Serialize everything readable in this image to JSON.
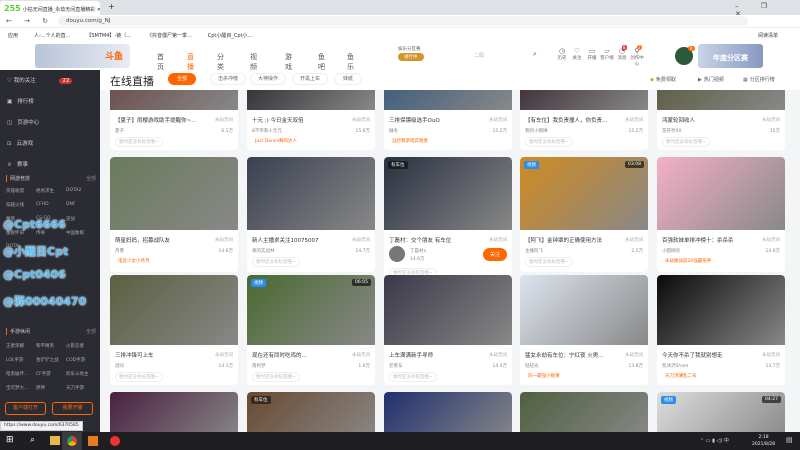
{
  "browser": {
    "tab_title": "小枯无间直播_永劫无间直播精彩",
    "tab_logo": "255",
    "url": "douyu.com/g_NJ",
    "bookmarks": [
      "应用",
      "人-...个人的直...",
      "【SMTM4】-链（...",
      "《抖音僵尸第一季...",
      "Cpt小醒目_Cpt小..."
    ],
    "reading_list": "阅读清单"
  },
  "site": {
    "logo": "斗鱼",
    "nav": [
      "首页",
      "直播",
      "分类",
      "视频",
      "游戏",
      "鱼吧",
      "鱼乐盛典"
    ],
    "promo": "娱乐分区赛",
    "promo_badge": "进行中",
    "search_placeholder": "二阳",
    "tools": [
      "历史",
      "关注",
      "开播",
      "客户端",
      "消息",
      "创作中心"
    ],
    "badges": {
      "client": "8",
      "msg": "3",
      "avatar": "6"
    },
    "banner": "年度分区赛"
  },
  "sidebar": {
    "follow": "我的关注",
    "follow_count": "22",
    "items": [
      "排行榜",
      "页游中心",
      "云游戏",
      "赛事"
    ],
    "pc": {
      "title": "网游竞技",
      "all": "全部",
      "games": [
        "英雄联盟",
        "绝地求生",
        "DOTA2",
        "穿越火线",
        "CFHD",
        "DNF",
        "魔兽",
        "CS:GO",
        "逆战",
        "魔兽怀旧",
        "传奇",
        "中国象棋",
        "DOTA"
      ]
    },
    "mobile": {
      "title": "手游休闲",
      "all": "全部",
      "games": [
        "王者荣耀",
        "和平精英",
        "火影忍者",
        "LOL手游",
        "金铲铲之战",
        "COD手游",
        "暗黑破坏...",
        "CF手游",
        "欢乐斗地主",
        "宝可梦大...",
        "原神",
        "天刀手游"
      ]
    },
    "open_client": "客户端打开",
    "start_stream": "我要开播",
    "watermarks": [
      "@Cpt6666",
      "@小醒目Cpt",
      "@Cpt0406",
      "@驿00040470"
    ]
  },
  "main": {
    "title": "在线直播",
    "filters": [
      "全部",
      "击杀冲榜",
      "大神操作",
      "开黑上车",
      "妹纸"
    ],
    "actions": [
      "免费领取",
      "热门视频",
      "分区排行榜"
    ],
    "cards": [
      {
        "title": "【夏子】雨樱游戏助手提醒你~...",
        "game": "永劫无间",
        "anchor": "夏子",
        "views": "6.1万",
        "tag": "暂时还没有标签哦~",
        "tag_type": "grey",
        "color": "#6a4a4a"
      },
      {
        "title": "十元 :) 今日金天双倍",
        "game": "永劫无间",
        "anchor": "8不带刺十元元",
        "views": "15.6万",
        "tag": "Just Dance舞的达人",
        "tag_type": "orange",
        "color": "#2a2a30"
      },
      {
        "title": "三排保镖级选手OuO",
        "game": "永劫无间",
        "anchor": "珊冬",
        "views": "15.2万",
        "tag": "远控教游戏奔跑者",
        "tag_type": "orange",
        "color": "#3a5a7a"
      },
      {
        "title": "【有车位】我负责撞人，你负责...",
        "game": "永劫无间",
        "anchor": "我的小钢琳",
        "views": "15.2万",
        "tag": "暂时还没有标签哦~",
        "tag_type": "grey",
        "color": "#3a2a34"
      },
      {
        "title": "鸿蒙轮回收人",
        "game": "永劫无间",
        "anchor": "花开乔XX",
        "views": "15万",
        "tag": "暂时还没有标签哦~",
        "tag_type": "grey",
        "color": "#5a5a40"
      },
      {
        "title": "萌星妈妈，招募战队友",
        "game": "永劫无间",
        "anchor": "月熹",
        "views": "14.6万",
        "tag": "电竞少女小月月",
        "tag_type": "orange",
        "color": "#6a7a5a"
      },
      {
        "title": "新人主播求关注10075007",
        "game": "永劫无间",
        "anchor": "真的实战林",
        "views": "14.7万",
        "tag": "暂时还没有标签哦~",
        "tag_type": "grey",
        "color": "#3a4050"
      },
      {
        "title": "丁磊村：交个朋友 有车位",
        "game": "永劫无间",
        "anchor": "丁磊村x",
        "views": "14.6万",
        "tag": "暂时还没有标签哦~",
        "tag_type": "grey",
        "color": "#2a3040",
        "follow": "关注",
        "badge": "有车位"
      },
      {
        "title": "【阿飞】金钟罩的正确使用方法",
        "game": "永劫无间",
        "anchor": "主播阿飞",
        "views": "2.5万",
        "tag": "暂时还没有标签哦~",
        "tag_type": "grey",
        "color": "#d08a20",
        "badge": "视频",
        "duration": "03:08"
      },
      {
        "title": "百强软妹单排冲榜十：杀杀杀",
        "game": "永劫无间",
        "anchor": "小甜桃的",
        "views": "14.6万",
        "tag": "永劫厮战前20強霸揽神",
        "tag_type": "orange",
        "color": "#f4b0c8"
      },
      {
        "title": "三排冲锋可上车",
        "game": "永劫无间",
        "anchor": "酒问",
        "views": "14.1万",
        "tag": "暂时还没有标签哦~",
        "tag_type": "grey",
        "color": "#5a6040"
      },
      {
        "title": "现在还有同时吃鸡的...",
        "game": "永劫无间",
        "anchor": "南柯梦",
        "views": "1.6万",
        "tag": "暂时还没有标签哦~",
        "tag_type": "grey",
        "color": "#4a6a30",
        "badge": "视频",
        "duration": "06:05"
      },
      {
        "title": "上车满满新手寻师",
        "game": "永劫无间",
        "anchor": "老莱东",
        "views": "14.4万",
        "tag": "暂时还没有标签哦~",
        "tag_type": "grey",
        "color": "#3a3848"
      },
      {
        "title": "猛女永劫有车位：宁红夜 火男...",
        "game": "永劫无间",
        "anchor": "轻轻光",
        "views": "13.8万",
        "tag": "同一最强小根薄",
        "tag_type": "orange",
        "color": "#dde4ee"
      },
      {
        "title": "今天你不杀了我就别想走",
        "game": "永劫无间",
        "anchor": "凯沐沢Sham",
        "views": "13.7万",
        "tag": "天刀顶薄乱二号",
        "tag_type": "orange",
        "color": "#0a0a0a"
      },
      {
        "color": "#4a2040"
      },
      {
        "color": "#6a4a30",
        "badge": "有车位"
      },
      {
        "color": "#203070"
      },
      {
        "color": "#506040"
      },
      {
        "color": "#ddd",
        "badge": "视频",
        "duration": "04:27"
      }
    ]
  },
  "status_url": "https://www.douyu.com/6370585",
  "taskbar": {
    "time": "2:18",
    "date": "2021/8/28"
  },
  "colors": {
    "accent": "#ff6600",
    "sidebar": "#2b2b33"
  }
}
